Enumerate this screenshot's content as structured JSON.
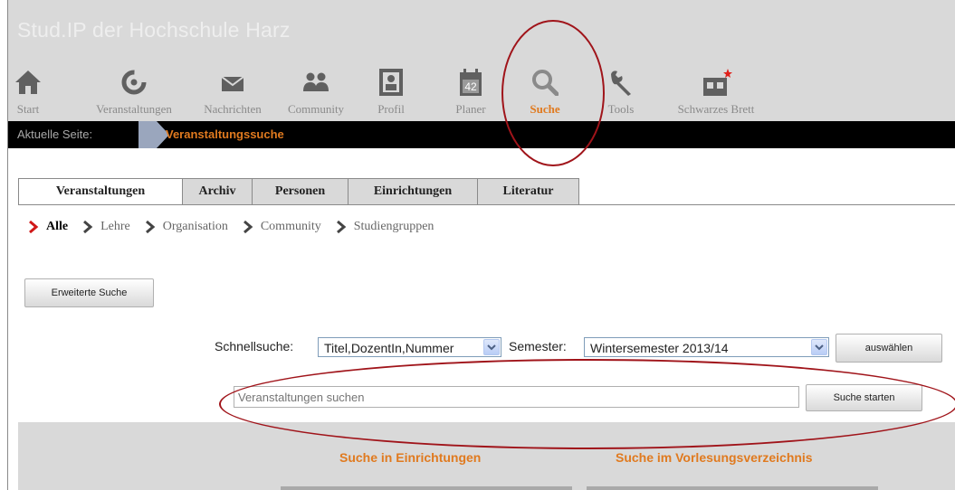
{
  "site_title": "Stud.IP der Hochschule Harz",
  "nav": [
    {
      "label": "Start",
      "icon": "home-icon"
    },
    {
      "label": "Veranstaltungen",
      "icon": "courses-icon"
    },
    {
      "label": "Nachrichten",
      "icon": "envelope-icon"
    },
    {
      "label": "Community",
      "icon": "people-icon"
    },
    {
      "label": "Profil",
      "icon": "profile-icon"
    },
    {
      "label": "Planer",
      "icon": "calendar-icon",
      "icon_text": "42"
    },
    {
      "label": "Suche",
      "icon": "search-icon",
      "active": true
    },
    {
      "label": "Tools",
      "icon": "wrench-icon"
    },
    {
      "label": "Schwarzes Brett",
      "icon": "board-icon"
    }
  ],
  "breadcrumb": {
    "label": "Aktuelle Seite:",
    "current": "Veranstaltungssuche"
  },
  "tabs": [
    {
      "label": "Veranstaltungen",
      "active": true
    },
    {
      "label": "Archiv"
    },
    {
      "label": "Personen"
    },
    {
      "label": "Einrichtungen"
    },
    {
      "label": "Literatur"
    }
  ],
  "subnav": [
    {
      "label": "Alle",
      "active": true
    },
    {
      "label": "Lehre"
    },
    {
      "label": "Organisation"
    },
    {
      "label": "Community"
    },
    {
      "label": "Studiengruppen"
    }
  ],
  "advanced_search_label": "Erweiterte Suche",
  "quick_search": {
    "label": "Schnellsuche:",
    "field_value": "Titel,DozentIn,Nummer",
    "semester_label": "Semester:",
    "semester_value": "Wintersemester 2013/14",
    "select_button": "auswählen",
    "search_placeholder": "Veranstaltungen suchen",
    "search_button": "Suche starten"
  },
  "bottom": {
    "left_title": "Suche in Einrichtungen",
    "right_title": "Suche im Vorlesungsverzeichnis"
  },
  "colors": {
    "accent": "#e07a1f",
    "header_bg": "#d9d9d9",
    "annotation": "#a0141a"
  }
}
